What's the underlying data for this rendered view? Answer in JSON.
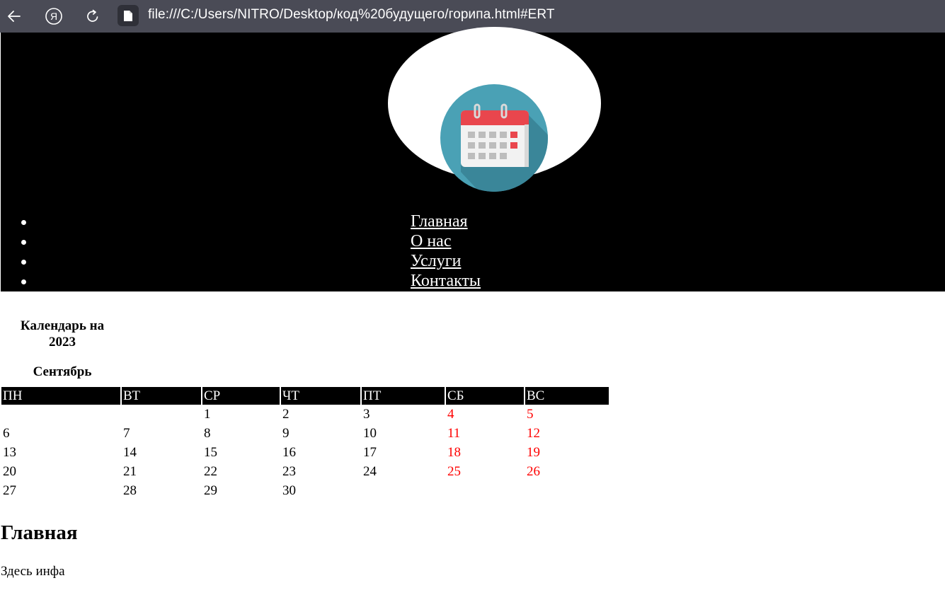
{
  "browser": {
    "url": "file:///C:/Users/NITRO/Desktop/код%20будущего/горипа.html#ERT",
    "icons": [
      "back-icon",
      "yandex-icon",
      "reload-icon",
      "file-icon"
    ]
  },
  "header": {
    "logo": "calendar-icon",
    "menu": [
      "Главная",
      "О нас",
      "Услуги",
      "Контакты"
    ]
  },
  "calendar": {
    "title": "Календарь на 2023",
    "month": "Сентябрь",
    "weekdays": [
      "ПН",
      "ВТ",
      "СР",
      "ЧТ",
      "ПТ",
      "СБ",
      "ВС"
    ],
    "weeks": [
      [
        "",
        "",
        "1",
        "2",
        "3",
        "4",
        "5"
      ],
      [
        "6",
        "7",
        "8",
        "9",
        "10",
        "11",
        "12"
      ],
      [
        "13",
        "14",
        "15",
        "16",
        "17",
        "18",
        "19"
      ],
      [
        "20",
        "21",
        "22",
        "23",
        "24",
        "25",
        "26"
      ],
      [
        "27",
        "28",
        "29",
        "30",
        "",
        "",
        ""
      ]
    ],
    "weekend_color": "#ff0000"
  },
  "main": {
    "heading": "Главная",
    "text": "Здесь инфа"
  }
}
